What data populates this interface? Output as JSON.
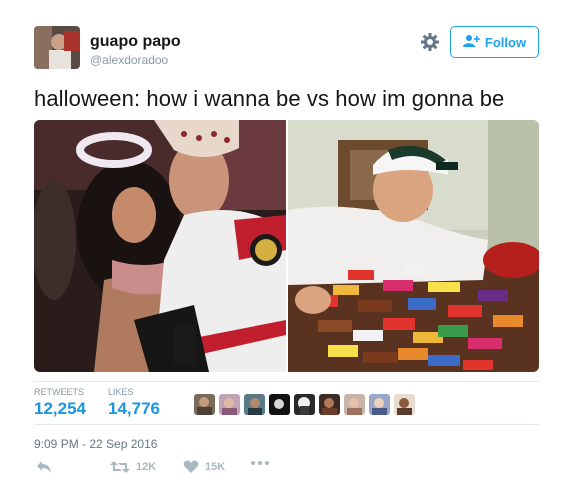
{
  "user": {
    "name": "guapo papo",
    "handle": "@alexdoradoo"
  },
  "follow_button": {
    "label": "Follow"
  },
  "tweet": {
    "text": "halloween: how i wanna be vs how im gonna be",
    "timestamp": "9:09 PM - 22 Sep 2016"
  },
  "stats": {
    "retweets_label": "RETWEETS",
    "retweets_value": "12,254",
    "likes_label": "LIKES",
    "likes_value": "14,776"
  },
  "actions": {
    "retweet_count": "12K",
    "like_count": "15K"
  },
  "icons": [
    "gear-icon",
    "follow-person-icon",
    "reply-icon",
    "retweet-icon",
    "heart-icon",
    "more-icon"
  ],
  "colors": {
    "accent": "#1da1f2",
    "count_blue": "#1b95e0",
    "muted": "#8899a6",
    "action_gray": "#aab8c2"
  }
}
